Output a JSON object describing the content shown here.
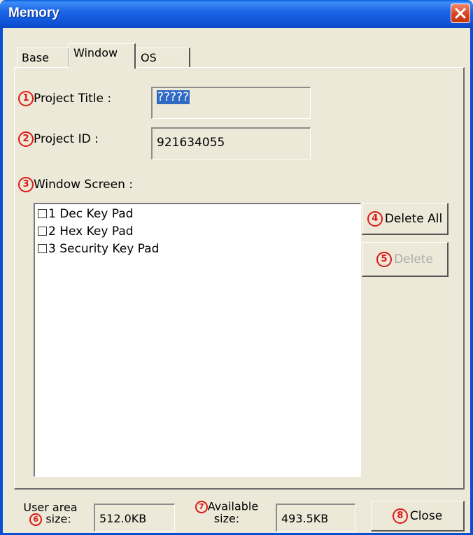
{
  "window": {
    "title": "Memory"
  },
  "tabs": [
    {
      "label": "Base"
    },
    {
      "label": "Window",
      "active": true
    },
    {
      "label": "OS"
    }
  ],
  "markers": [
    "1",
    "2",
    "3",
    "4",
    "5",
    "6",
    "7",
    "8"
  ],
  "project_title": {
    "label": "Project Title :",
    "value": "?????"
  },
  "project_id": {
    "label": "Project ID :",
    "value": "921634055"
  },
  "window_screen": {
    "label": "Window Screen :",
    "items": [
      {
        "label": "1 Dec Key Pad",
        "checked": false
      },
      {
        "label": "2 Hex Key Pad",
        "checked": false
      },
      {
        "label": "3 Security Key Pad",
        "checked": false
      }
    ]
  },
  "buttons": {
    "delete_all": "Delete All",
    "delete": "Delete",
    "close": "Close"
  },
  "footer": {
    "user_area_line1": "User area",
    "user_area_line2": "size:",
    "user_area_value": "512.0KB",
    "available_line1": "Available",
    "available_line2": "size:",
    "available_value": "493.5KB"
  },
  "colors": {
    "title_bar": "#1c66e6",
    "marker": "#e01818",
    "selection": "#316ac5",
    "dialog_bg": "#ece9d8"
  }
}
